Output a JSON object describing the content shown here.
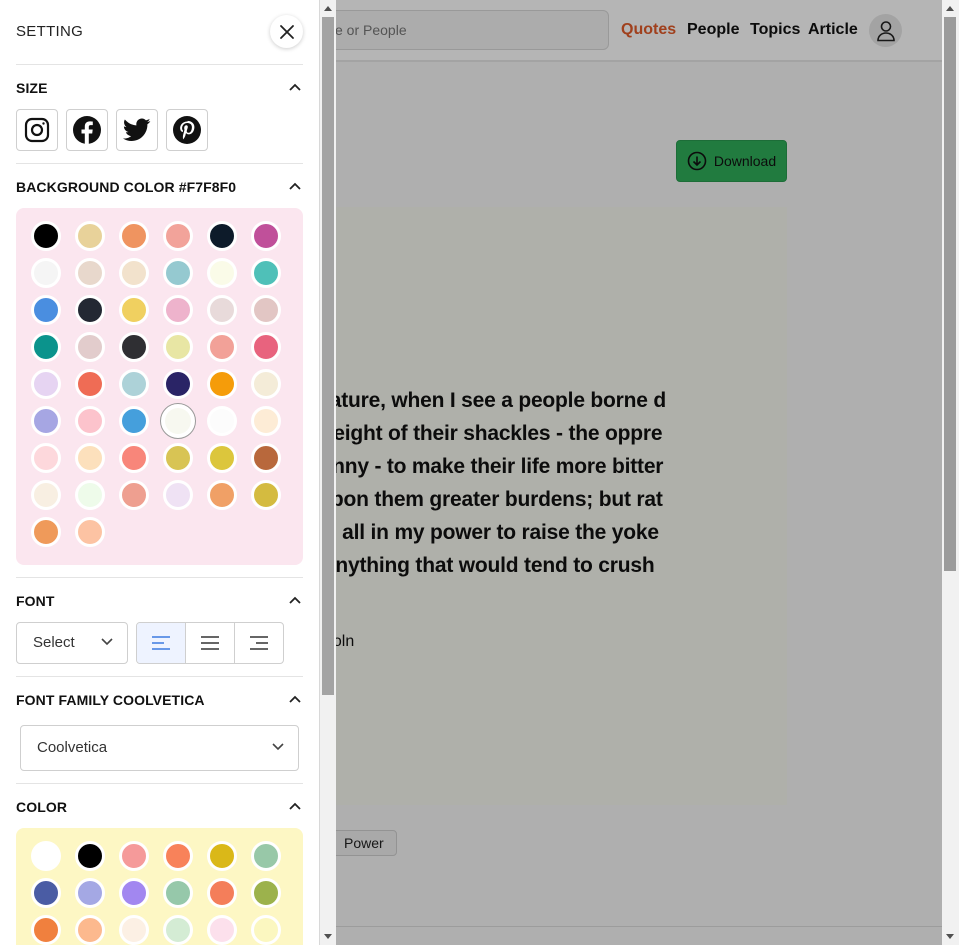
{
  "header": {
    "search_placeholder": "e or People",
    "nav": [
      "Quotes",
      "People",
      "Topics",
      "Article"
    ],
    "active_nav": "Quotes",
    "accent_color": "#e25b2a"
  },
  "download": {
    "label": "Download",
    "color": "#2fae5a"
  },
  "quote": {
    "lines": [
      "y nature, when I see a people borne d",
      "e weight of their shackles - the oppre",
      "granny - to make their life more bitter",
      "g upon them greater burdens; but rat",
      "l do all in my power to raise the yoke",
      "ld anything that would tend to crush"
    ],
    "author": "ncoln",
    "background": "#F7F8F0"
  },
  "tags": [
    "Power"
  ],
  "drawer": {
    "title": "SETTING",
    "sections": {
      "size": "SIZE",
      "background": "BACKGROUND COLOR #F7F8F0",
      "font": "FONT",
      "font_family": "FONT FAMILY COOLVETICA",
      "color": "COLOR"
    },
    "size_buttons": [
      "instagram-icon",
      "facebook-icon",
      "twitter-icon",
      "pinterest-icon"
    ],
    "background_colors": [
      "#000000",
      "#e8d29a",
      "#ef9460",
      "#f2a39a",
      "#0d1b2a",
      "#c0509a",
      "#f5f5f5",
      "#e8d8cc",
      "#f2e2cc",
      "#95c9d0",
      "#fafbe8",
      "#4fc0b8",
      "#4a8ee0",
      "#232833",
      "#f0d060",
      "#eeb3cc",
      "#e8dada",
      "#e2c6c4",
      "#0b938c",
      "#e2cccc",
      "#2f2f33",
      "#e8e6a4",
      "#f2a198",
      "#e8637e",
      "#e6d4f2",
      "#ef6c55",
      "#add2d8",
      "#2a2466",
      "#f59c0a",
      "#f4ecd8",
      "#a6a6e3",
      "#fcc3cc",
      "#459fdc",
      "#f7f8f0",
      "#fcfcfc",
      "#fdecd6",
      "#fdd8dc",
      "#fce0bc",
      "#f8867a",
      "#d8c454",
      "#dcc63c",
      "#b8683c",
      "#f8efe2",
      "#eefbea",
      "#ee9f90",
      "#efe2f4",
      "#f0a066",
      "#d4bb40",
      "#ef9a5a",
      "#fcc3a3"
    ],
    "selected_background": "#f7f8f0",
    "font_select": "Select",
    "alignments": [
      "align-left",
      "align-center",
      "align-right"
    ],
    "active_alignment": "align-left",
    "font_family_value": "Coolvetica",
    "text_colors": [
      "#ffffff",
      "#000000",
      "#f59a9a",
      "#f8825a",
      "#dab818",
      "#98c8a8",
      "#4a5ca4",
      "#a4a8e4",
      "#a287f0",
      "#96c8aa",
      "#f47e5a",
      "#9cb24c",
      "#f0803e",
      "#fcb98e",
      "#fcf0e4",
      "#d4ecd4",
      "#fce0ec",
      "#fbf7c0"
    ]
  }
}
